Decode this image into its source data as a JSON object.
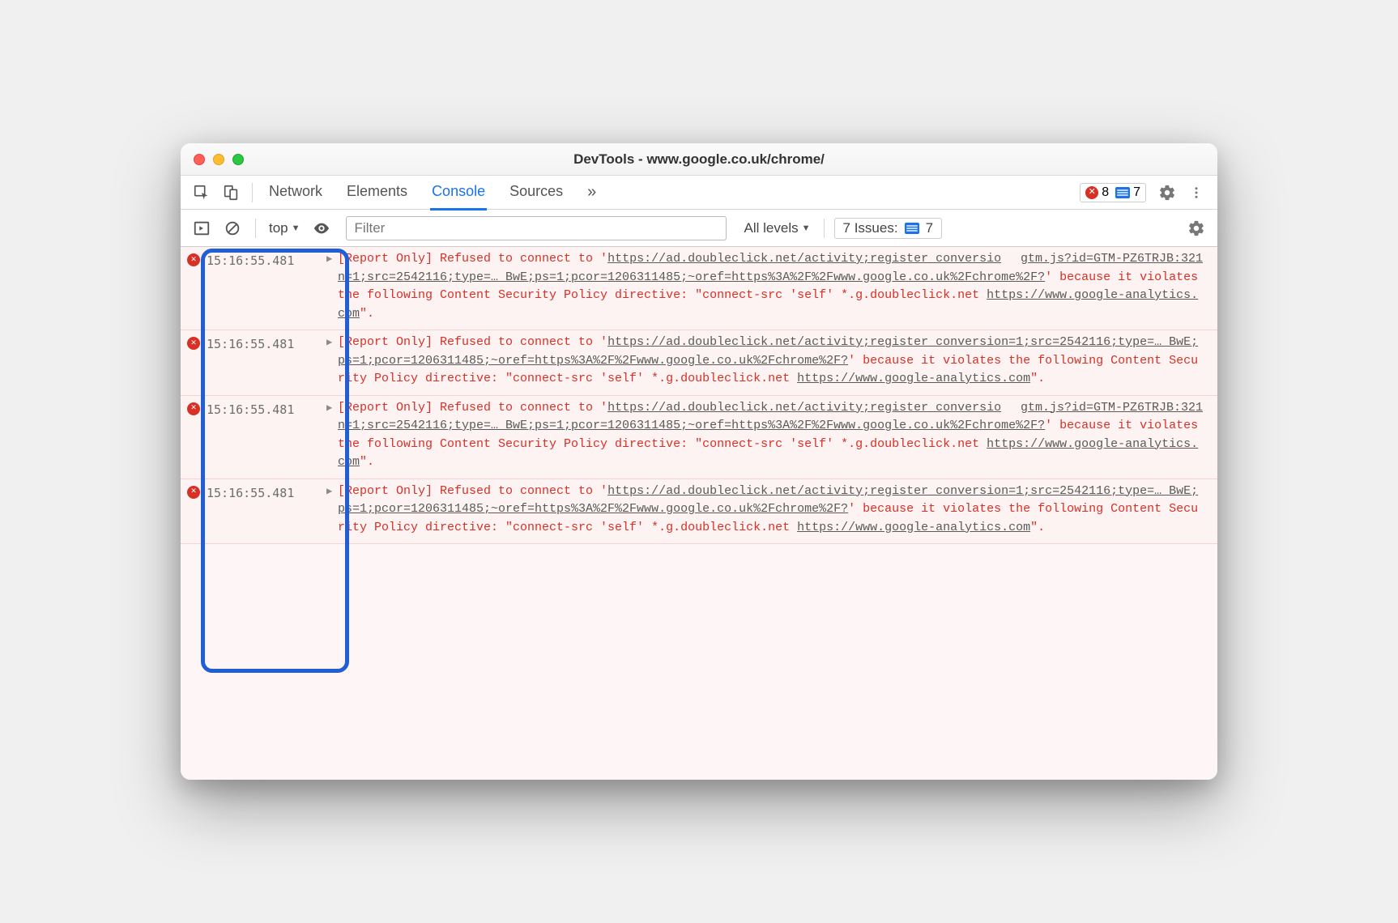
{
  "window": {
    "title": "DevTools - www.google.co.uk/chrome/"
  },
  "tabs": {
    "network": "Network",
    "elements": "Elements",
    "console": "Console",
    "sources": "Sources"
  },
  "badges": {
    "errors": "8",
    "messages": "7"
  },
  "filterRow": {
    "context": "top",
    "filterPlaceholder": "Filter",
    "levels": "All levels",
    "issuesLabel": "7 Issues:",
    "issuesCount": "7"
  },
  "logs": [
    {
      "timestamp": "15:16:55.481",
      "source": "gtm.js?id=GTM-PZ6TRJB:321",
      "pre": "[Report Only] Refused to connect to '",
      "url": "https://ad.doubleclick.net/activity;register_conversion=1;src=2542116;type=… BwE;ps=1;pcor=1206311485;~oref=https%3A%2F%2Fwww.google.co.uk%2Fchrome%2F?",
      "mid": "' because it violates the following Content Security Policy directive: \"connect-src 'self' *.g.doubleclick.net ",
      "url2": "https://www.google-analytics.com",
      "post": "\"."
    },
    {
      "timestamp": "15:16:55.481",
      "source": "",
      "pre": "[Report Only] Refused to connect to '",
      "url": "https://ad.doubleclick.net/activity;register_conversion=1;src=2542116;type=… BwE;ps=1;pcor=1206311485;~oref=https%3A%2F%2Fwww.google.co.uk%2Fchrome%2F?",
      "mid": "' because it violates the following Content Security Policy directive: \"connect-src 'self' *.g.doubleclick.net ",
      "url2": "https://www.google-analytics.com",
      "post": "\"."
    },
    {
      "timestamp": "15:16:55.481",
      "source": "gtm.js?id=GTM-PZ6TRJB:321",
      "pre": "[Report Only] Refused to connect to '",
      "url": "https://ad.doubleclick.net/activity;register_conversion=1;src=2542116;type=… BwE;ps=1;pcor=1206311485;~oref=https%3A%2F%2Fwww.google.co.uk%2Fchrome%2F?",
      "mid": "' because it violates the following Content Security Policy directive: \"connect-src 'self' *.g.doubleclick.net ",
      "url2": "https://www.google-analytics.com",
      "post": "\"."
    },
    {
      "timestamp": "15:16:55.481",
      "source": "",
      "pre": "[Report Only] Refused to connect to '",
      "url": "https://ad.doubleclick.net/activity;register_conversion=1;src=2542116;type=… BwE;ps=1;pcor=1206311485;~oref=https%3A%2F%2Fwww.google.co.uk%2Fchrome%2F?",
      "mid": "' because it violates the following Content Security Policy directive: \"connect-src 'self' *.g.doubleclick.net ",
      "url2": "https://www.google-analytics.com",
      "post": "\"."
    }
  ]
}
